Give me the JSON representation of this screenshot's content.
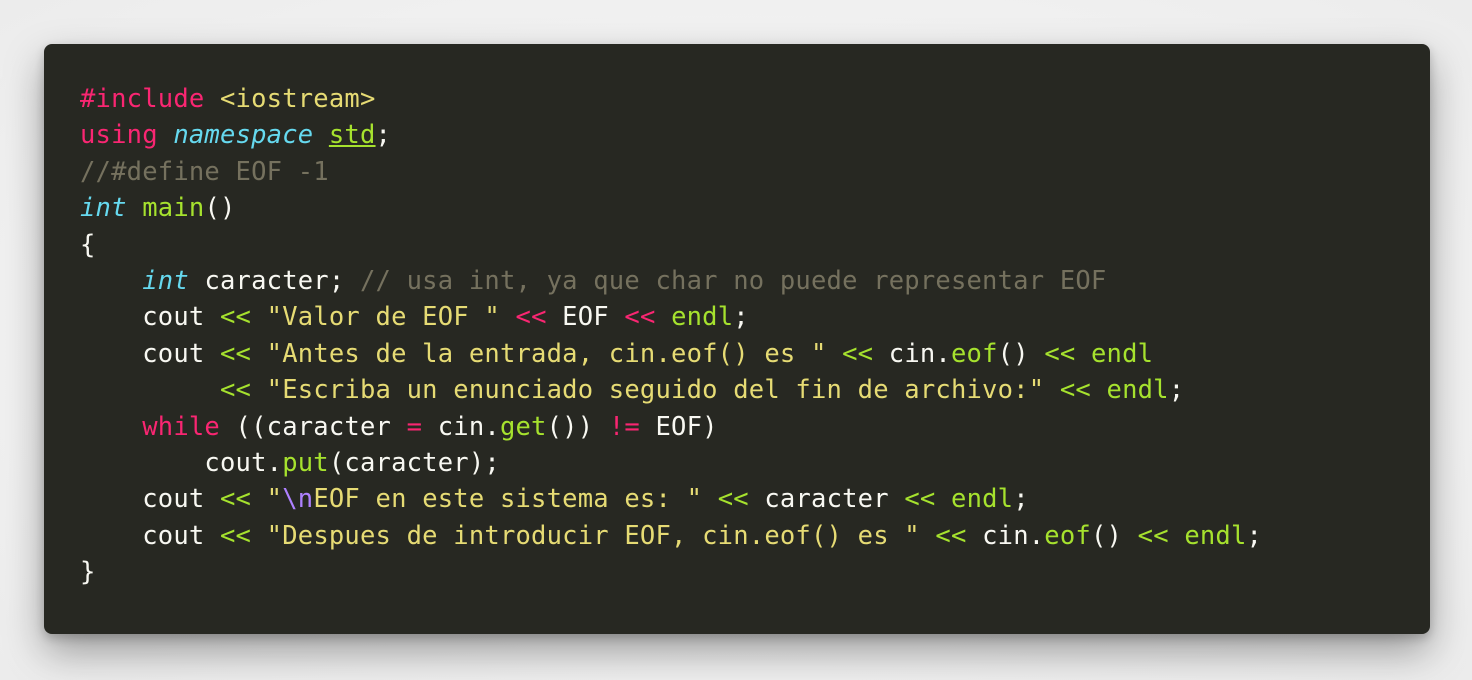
{
  "editor": {
    "language": "cpp",
    "theme_background": "#272822",
    "colors": {
      "keyword": "#f92672",
      "type": "#66d9ef",
      "string": "#e6db74",
      "function": "#a6e22e",
      "comment": "#75715e",
      "escape": "#ae81ff",
      "plain": "#f8f8f2"
    },
    "lines": [
      {
        "tokens": [
          {
            "t": "kw",
            "v": "#include"
          },
          {
            "t": "plain",
            "v": " "
          },
          {
            "t": "str",
            "v": "<iostream>"
          }
        ]
      },
      {
        "tokens": [
          {
            "t": "kw",
            "v": "using"
          },
          {
            "t": "plain",
            "v": " "
          },
          {
            "t": "type",
            "v": "namespace"
          },
          {
            "t": "plain",
            "v": " "
          },
          {
            "t": "ns",
            "v": "std"
          },
          {
            "t": "plain",
            "v": ";"
          }
        ]
      },
      {
        "tokens": [
          {
            "t": "cmt",
            "v": "//#define EOF -1"
          }
        ]
      },
      {
        "tokens": [
          {
            "t": "type",
            "v": "int"
          },
          {
            "t": "plain",
            "v": " "
          },
          {
            "t": "fn",
            "v": "main"
          },
          {
            "t": "plain",
            "v": "()"
          }
        ]
      },
      {
        "tokens": [
          {
            "t": "plain",
            "v": "{"
          }
        ]
      },
      {
        "tokens": [
          {
            "t": "plain",
            "v": "    "
          },
          {
            "t": "type",
            "v": "int"
          },
          {
            "t": "plain",
            "v": " caracter; "
          },
          {
            "t": "cmt",
            "v": "// usa int, ya que char no puede representar EOF"
          }
        ]
      },
      {
        "tokens": [
          {
            "t": "plain",
            "v": "    cout "
          },
          {
            "t": "fn",
            "v": "<<"
          },
          {
            "t": "plain",
            "v": " "
          },
          {
            "t": "str",
            "v": "\"Valor de EOF \""
          },
          {
            "t": "plain",
            "v": " "
          },
          {
            "t": "kw",
            "v": "<<"
          },
          {
            "t": "plain",
            "v": " EOF "
          },
          {
            "t": "kw",
            "v": "<<"
          },
          {
            "t": "plain",
            "v": " "
          },
          {
            "t": "fn",
            "v": "endl"
          },
          {
            "t": "plain",
            "v": ";"
          }
        ]
      },
      {
        "tokens": [
          {
            "t": "plain",
            "v": "    cout "
          },
          {
            "t": "fn",
            "v": "<<"
          },
          {
            "t": "plain",
            "v": " "
          },
          {
            "t": "str",
            "v": "\"Antes de la entrada, cin.eof() es \""
          },
          {
            "t": "plain",
            "v": " "
          },
          {
            "t": "fn",
            "v": "<<"
          },
          {
            "t": "plain",
            "v": " cin."
          },
          {
            "t": "fn",
            "v": "eof"
          },
          {
            "t": "plain",
            "v": "() "
          },
          {
            "t": "fn",
            "v": "<<"
          },
          {
            "t": "plain",
            "v": " "
          },
          {
            "t": "fn",
            "v": "endl"
          }
        ]
      },
      {
        "tokens": [
          {
            "t": "plain",
            "v": "         "
          },
          {
            "t": "fn",
            "v": "<<"
          },
          {
            "t": "plain",
            "v": " "
          },
          {
            "t": "str",
            "v": "\"Escriba un enunciado seguido del fin de archivo:\""
          },
          {
            "t": "plain",
            "v": " "
          },
          {
            "t": "fn",
            "v": "<<"
          },
          {
            "t": "plain",
            "v": " "
          },
          {
            "t": "fn",
            "v": "endl"
          },
          {
            "t": "plain",
            "v": ";"
          }
        ]
      },
      {
        "tokens": [
          {
            "t": "plain",
            "v": "    "
          },
          {
            "t": "kw",
            "v": "while"
          },
          {
            "t": "plain",
            "v": " ((caracter "
          },
          {
            "t": "kw",
            "v": "="
          },
          {
            "t": "plain",
            "v": " cin."
          },
          {
            "t": "fn",
            "v": "get"
          },
          {
            "t": "plain",
            "v": "()) "
          },
          {
            "t": "kw",
            "v": "!="
          },
          {
            "t": "plain",
            "v": " EOF)"
          }
        ]
      },
      {
        "tokens": [
          {
            "t": "plain",
            "v": "        cout."
          },
          {
            "t": "fn",
            "v": "put"
          },
          {
            "t": "plain",
            "v": "(caracter);"
          }
        ]
      },
      {
        "tokens": [
          {
            "t": "plain",
            "v": "    cout "
          },
          {
            "t": "fn",
            "v": "<<"
          },
          {
            "t": "plain",
            "v": " "
          },
          {
            "t": "str",
            "v": "\""
          },
          {
            "t": "esc",
            "v": "\\n"
          },
          {
            "t": "str",
            "v": "EOF en este sistema es: \""
          },
          {
            "t": "plain",
            "v": " "
          },
          {
            "t": "fn",
            "v": "<<"
          },
          {
            "t": "plain",
            "v": " caracter "
          },
          {
            "t": "fn",
            "v": "<<"
          },
          {
            "t": "plain",
            "v": " "
          },
          {
            "t": "fn",
            "v": "endl"
          },
          {
            "t": "plain",
            "v": ";"
          }
        ]
      },
      {
        "tokens": [
          {
            "t": "plain",
            "v": "    cout "
          },
          {
            "t": "fn",
            "v": "<<"
          },
          {
            "t": "plain",
            "v": " "
          },
          {
            "t": "str",
            "v": "\"Despues de introducir EOF, cin.eof() es \""
          },
          {
            "t": "plain",
            "v": " "
          },
          {
            "t": "fn",
            "v": "<<"
          },
          {
            "t": "plain",
            "v": " cin."
          },
          {
            "t": "fn",
            "v": "eof"
          },
          {
            "t": "plain",
            "v": "() "
          },
          {
            "t": "fn",
            "v": "<<"
          },
          {
            "t": "plain",
            "v": " "
          },
          {
            "t": "fn",
            "v": "endl"
          },
          {
            "t": "plain",
            "v": ";"
          }
        ]
      },
      {
        "tokens": [
          {
            "t": "plain",
            "v": "}"
          }
        ]
      }
    ]
  }
}
